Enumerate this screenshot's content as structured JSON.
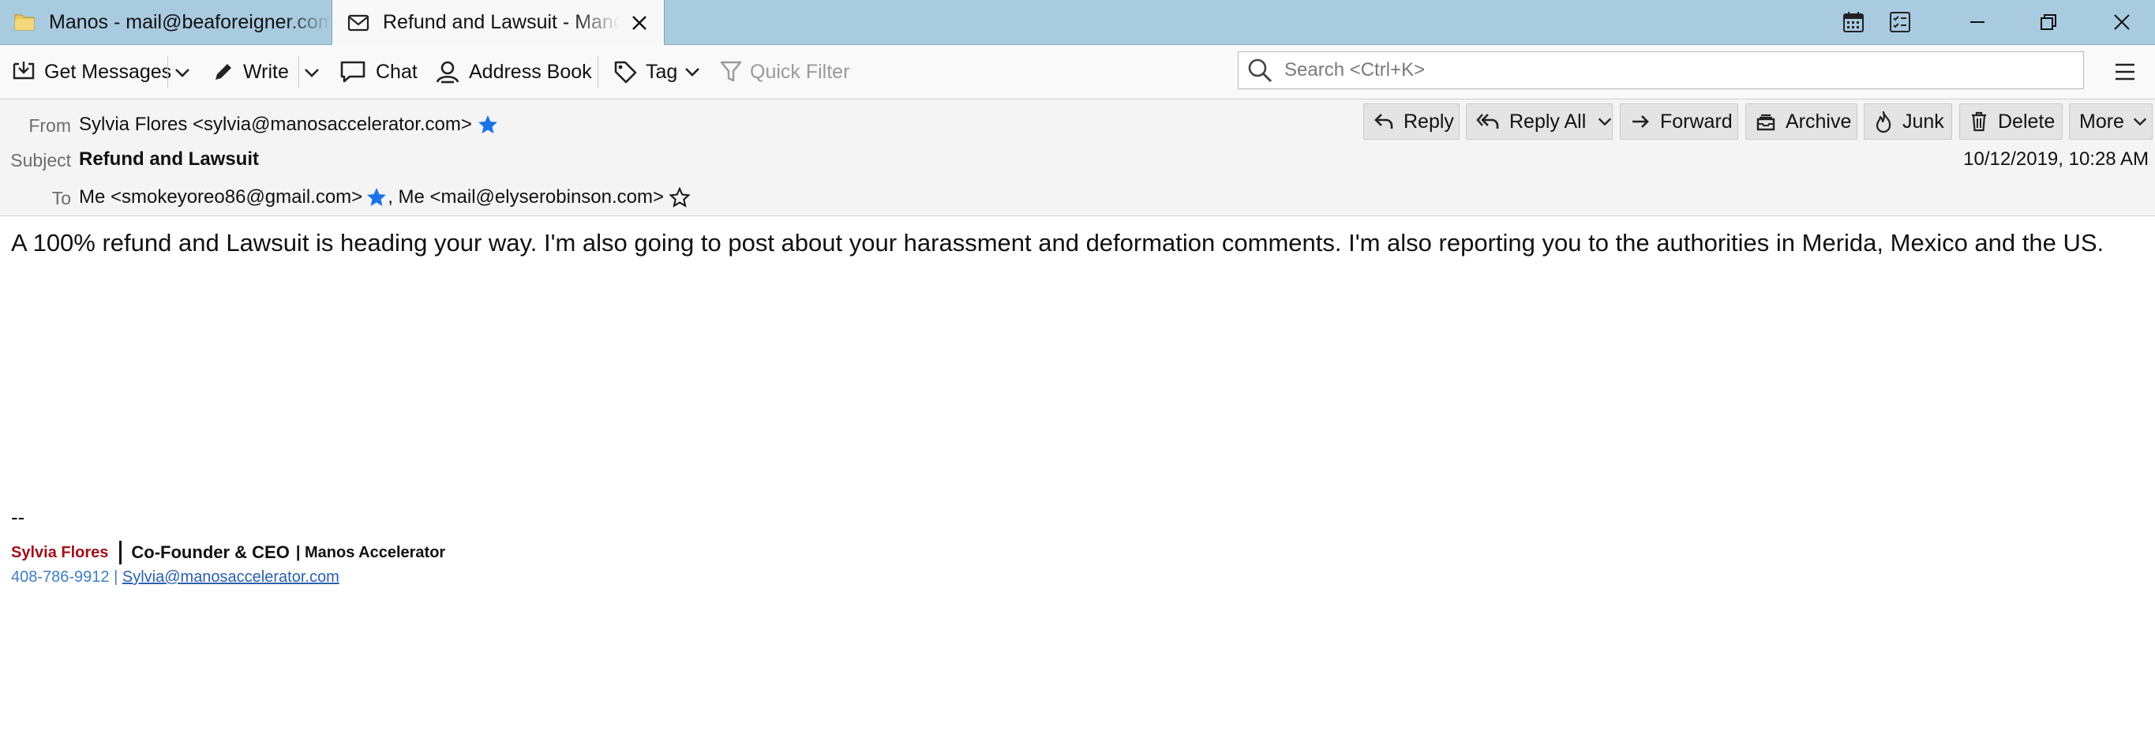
{
  "tabs": [
    {
      "label": "Manos - mail@beaforeigner.com",
      "icon": "folder-icon"
    },
    {
      "label": "Refund and Lawsuit - Manos",
      "icon": "envelope-icon"
    }
  ],
  "toolbar": {
    "get_messages": "Get Messages",
    "write": "Write",
    "chat": "Chat",
    "address_book": "Address Book",
    "tag": "Tag",
    "quick_filter": "Quick Filter",
    "search_placeholder": "Search <Ctrl+K>"
  },
  "header": {
    "from_label": "From",
    "from_value": "Sylvia Flores <sylvia@manosaccelerator.com>",
    "subject_label": "Subject",
    "subject_value": "Refund and Lawsuit",
    "to_label": "To",
    "to_1": "Me <smokeyoreo86@gmail.com>",
    "to_sep": ", Me <mail@elyserobinson.com>",
    "date": "10/12/2019, 10:28 AM",
    "actions": {
      "reply": "Reply",
      "reply_all": "Reply All",
      "forward": "Forward",
      "archive": "Archive",
      "junk": "Junk",
      "delete": "Delete",
      "more": "More"
    }
  },
  "body": {
    "text": "A 100% refund and Lawsuit is heading your way. I'm also going to post about your harassment and deformation comments. I'm also reporting you to the authorities in Merida, Mexico and the US."
  },
  "signature": {
    "dash": "--",
    "name": "Sylvia Flores",
    "title": "Co-Founder & CEO",
    "company": "| Manos Accelerator",
    "phone": "408-786-9912 |",
    "email": "Sylvia@manosaccelerator.com"
  },
  "colors": {
    "tabbar_bg": "#a9cbe0",
    "star_blue": "#1a73e8",
    "sig_name_red": "#a0101a",
    "link_blue": "#2a5fb0"
  }
}
